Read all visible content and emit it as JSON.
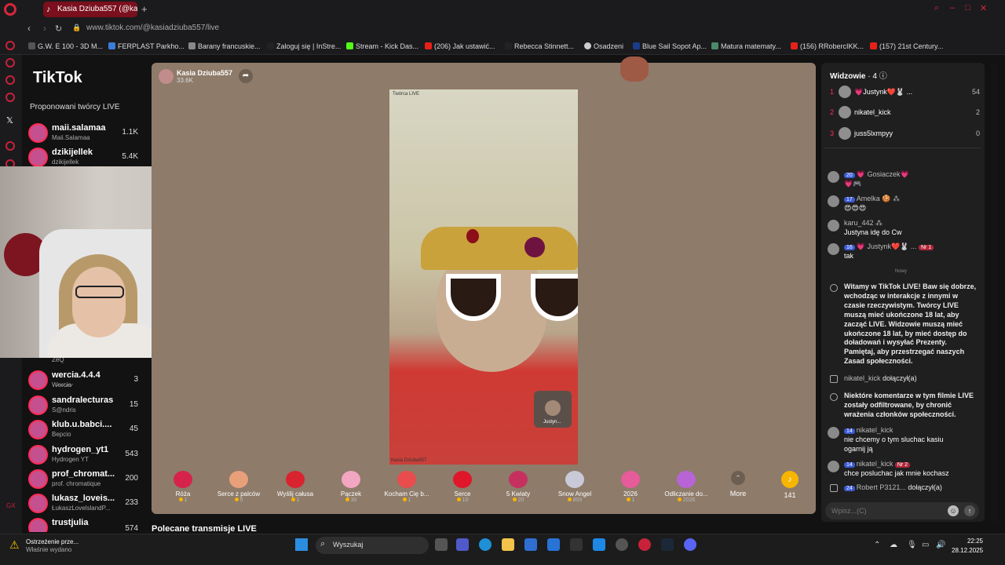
{
  "browser": {
    "tab_title": "Kasia Dziuba557 (@ka...",
    "url": "www.tiktok.com/@kasiadziuba557/live",
    "bookmarks": [
      "G.W. E 100 - 3D M...",
      "FERPLAST Parkho...",
      "Barany francuskie...",
      "Zaloguj się | InStre...",
      "Stream - Kick Das...",
      "(206) Jak ustawić...",
      "Rebecca Stinnett...",
      "Osadzeni",
      "Blue Sail Sopot Ap...",
      "Matura matematy...",
      "(156) RRobercIKK...",
      "(157) 21st Century..."
    ]
  },
  "sidebar": {
    "logo": "TikTok",
    "title": "Proponowani twórcy LIVE",
    "creators": [
      {
        "name": "maii.salamaa",
        "sub": "Maii.Salamaa",
        "count": "1.1K"
      },
      {
        "name": "dzikijellek",
        "sub": "dzikijellek",
        "count": "5.4K"
      },
      {
        "name": "",
        "sub": "ZeQ",
        "count": ""
      },
      {
        "name": "wercia.4.4.4",
        "sub": "W̷e̷r̷c̷i̷a̷",
        "count": "3"
      },
      {
        "name": "sandralecturas",
        "sub": "S@ndris",
        "count": "15"
      },
      {
        "name": "klub.u.babci....",
        "sub": "Bepcio",
        "count": "45"
      },
      {
        "name": "hydrogen_yt1",
        "sub": "Hydrogen YT",
        "count": "543"
      },
      {
        "name": "prof_chromat...",
        "sub": "prof. chromatique",
        "count": "200"
      },
      {
        "name": "lukasz_loveis...",
        "sub": "ŁukaszLovelslandP...",
        "count": "233"
      },
      {
        "name": "trustjulia",
        "sub": "",
        "count": "574"
      }
    ]
  },
  "stream": {
    "name": "Kasia Dziuba557",
    "followers": "33.6K",
    "video_top_label": "Twórca LIVE",
    "video_bottom_label": "Kasia Dziuba557",
    "minicam_label": "Justyn..."
  },
  "gifts": [
    {
      "name": "Róża",
      "price": "1",
      "color": "#d6234b"
    },
    {
      "name": "Serce z palców",
      "price": "5",
      "color": "#e8a07a"
    },
    {
      "name": "Wyślij całusa",
      "price": "1",
      "color": "#d9242f"
    },
    {
      "name": "Pączek",
      "price": "30",
      "color": "#f2a6c2"
    },
    {
      "name": "Kocham Cię b...",
      "price": "1",
      "color": "#e94c4c"
    },
    {
      "name": "Serce",
      "price": "10",
      "color": "#e0162b"
    },
    {
      "name": "5 Kwiaty",
      "price": "20",
      "color": "#c6305f"
    },
    {
      "name": "Snow Angel",
      "price": "800",
      "color": "#c9c9d8"
    },
    {
      "name": "2026",
      "price": "1",
      "color": "#e65b9a"
    },
    {
      "name": "Odliczanie do...",
      "price": "2026",
      "color": "#b864d6"
    }
  ],
  "more_label": "More",
  "coins": "141",
  "recommended": "Polecane transmisje LIVE",
  "viewers": {
    "title": "Widzowie",
    "count": "· 4",
    "list": [
      {
        "rank": "1",
        "name": "💗Justynk❤️🐰 ...",
        "score": "54"
      },
      {
        "rank": "2",
        "name": "nikatel_kick",
        "score": "2"
      },
      {
        "rank": "3",
        "name": "juss5lxmpyy",
        "score": "0"
      }
    ]
  },
  "chat": [
    {
      "badge": "20",
      "name": "💗 Gosiaczek💗",
      "text": "💗🎮"
    },
    {
      "badge": "17",
      "name": "Amelka 🍪 ⁂",
      "text": "😍😍😍"
    },
    {
      "badge": "",
      "name": "karu_442 ⁂",
      "text": "Justyna idę do Cw"
    },
    {
      "badge": "16",
      "name": "💗 Justynk❤️🐰 ...",
      "text": "tak",
      "rank_badge": "Nr 1"
    }
  ],
  "new_label": "Nowy",
  "system_welcome": "Witamy w TikTok LIVE! Baw się dobrze, wchodząc w interakcje z innymi w czasie rzeczywistym. Twórcy LIVE muszą mieć ukończone 18 lat, aby zacząć LIVE. Widzowie muszą mieć ukończone 18 lat, by mieć dostęp do doładowań i wysyłać Prezenty. Pamiętaj, aby przestrzegać naszych Zasad społeczności.",
  "join1": {
    "name": "nikatel_kick",
    "action": "dołączył(a)"
  },
  "system_filter": "Niektóre komentarze w tym filmie LIVE zostały odfiltrowane, by chronić wrażenia członków społeczności.",
  "chat2": [
    {
      "badge": "14",
      "name": "nikatel_kick",
      "text": "nie chcemy o tym sluchac kasiu",
      "text2": "ogarnij ją"
    },
    {
      "badge": "14",
      "name": "nikatel_kick",
      "text": "chce posluchac jak mnie kochasz",
      "rank_badge": "Nr 2"
    }
  ],
  "join2": {
    "badge": "24",
    "name": "Robert P3121...",
    "action": "dołączył(a)"
  },
  "chat_placeholder": "Wpisz...(C)",
  "taskbar": {
    "warn_title": "Ostrzeżenie prze...",
    "warn_sub": "Właśnie wydano",
    "search": "Wyszukaj",
    "time": "22:25",
    "date": "28.12.2025"
  }
}
